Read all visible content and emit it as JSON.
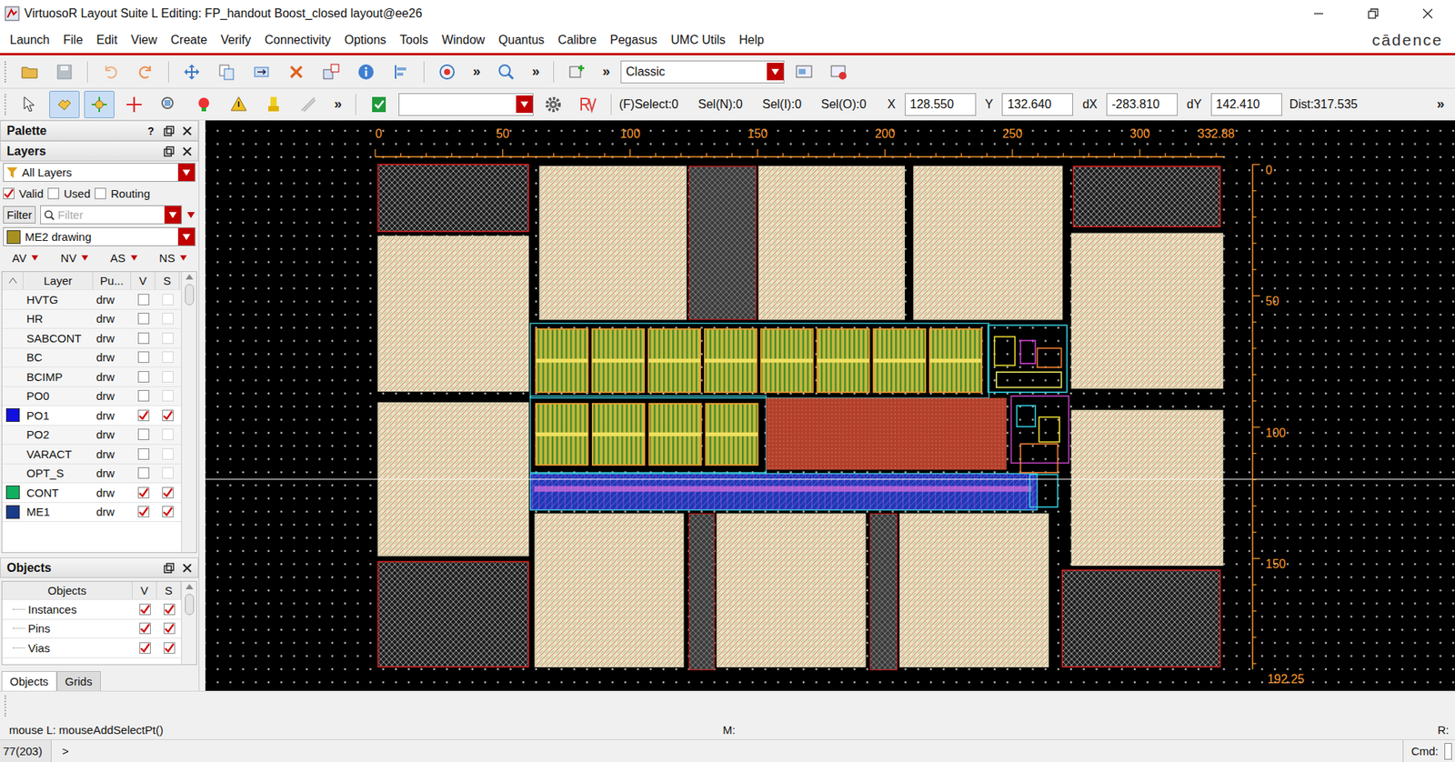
{
  "window": {
    "title": "VirtuosoR Layout Suite L Editing: FP_handout Boost_closed layout@ee26"
  },
  "menu": [
    "Launch",
    "File",
    "Edit",
    "View",
    "Create",
    "Verify",
    "Connectivity",
    "Options",
    "Tools",
    "Window",
    "Quantus",
    "Calibre",
    "Pegasus",
    "UMC Utils",
    "Help"
  ],
  "logo": "cādence",
  "toolbar": {
    "overflow": "»",
    "style": "Classic"
  },
  "select_bar": {
    "items": [
      "(F)Select:0",
      "Sel(N):0",
      "Sel(I):0",
      "Sel(O):0"
    ],
    "fields": [
      {
        "label": "X",
        "value": "128.550"
      },
      {
        "label": "Y",
        "value": "132.640"
      },
      {
        "label": "dX",
        "value": "-283.810"
      },
      {
        "label": "dY",
        "value": "142.410"
      }
    ],
    "distance": "Dist:317.535",
    "overflow": "»"
  },
  "palette": {
    "title": "Palette",
    "help": "?"
  },
  "layers": {
    "title": "Layers",
    "filter_set": "All Layers",
    "options": [
      {
        "label": "Valid",
        "checked": true
      },
      {
        "label": "Used",
        "checked": false
      },
      {
        "label": "Routing",
        "checked": false
      }
    ],
    "filter_button": "Filter",
    "filter_placeholder": "Filter",
    "current": {
      "label": "ME2 drawing",
      "color": "#a89020"
    },
    "visibility": [
      "AV",
      "NV",
      "AS",
      "NS"
    ],
    "columns": [
      "Layer",
      "Pu...",
      "V",
      "S"
    ],
    "rows": [
      {
        "name": "HVTG",
        "purpose": "drw",
        "visible": false,
        "selectable": false
      },
      {
        "name": "HR",
        "purpose": "drw",
        "visible": false,
        "selectable": false
      },
      {
        "name": "SABCONT",
        "purpose": "drw",
        "visible": false,
        "selectable": false
      },
      {
        "name": "BC",
        "purpose": "drw",
        "visible": false,
        "selectable": false
      },
      {
        "name": "BCIMP",
        "purpose": "drw",
        "visible": false,
        "selectable": false
      },
      {
        "name": "PO0",
        "purpose": "drw",
        "visible": false,
        "selectable": false
      },
      {
        "name": "PO1",
        "purpose": "drw",
        "visible": true,
        "selectable": true,
        "color": "#1010e0"
      },
      {
        "name": "PO2",
        "purpose": "drw",
        "visible": false,
        "selectable": false
      },
      {
        "name": "VARACT",
        "purpose": "drw",
        "visible": false,
        "selectable": false
      },
      {
        "name": "OPT_S",
        "purpose": "drw",
        "visible": false,
        "selectable": false
      },
      {
        "name": "CONT",
        "purpose": "drw",
        "visible": true,
        "selectable": true,
        "color": "#10b060"
      },
      {
        "name": "ME1",
        "purpose": "drw",
        "visible": true,
        "selectable": true,
        "color": "#1a3a8a"
      }
    ]
  },
  "objects": {
    "title": "Objects",
    "columns": [
      "Objects",
      "V",
      "S"
    ],
    "rows": [
      {
        "label": "Instances",
        "visible": true,
        "selectable": true
      },
      {
        "label": "Pins",
        "visible": true,
        "selectable": true
      },
      {
        "label": "Vias",
        "visible": true,
        "selectable": true
      }
    ]
  },
  "tabs": [
    {
      "label": "Objects",
      "selected": true
    },
    {
      "label": "Grids",
      "selected": false
    }
  ],
  "canvas": {
    "top_ruler": [
      "0",
      "50",
      "100",
      "150",
      "200",
      "250",
      "300",
      "332.88"
    ],
    "right_ruler": [
      "0",
      "50",
      "100",
      "150",
      "192.25"
    ]
  },
  "status": {
    "mouse": "mouse L: mouseAddSelectPt()",
    "middle": "M:",
    "right": "R:",
    "count": "77(203)",
    "prompt": ">",
    "cmd": "Cmd:"
  }
}
